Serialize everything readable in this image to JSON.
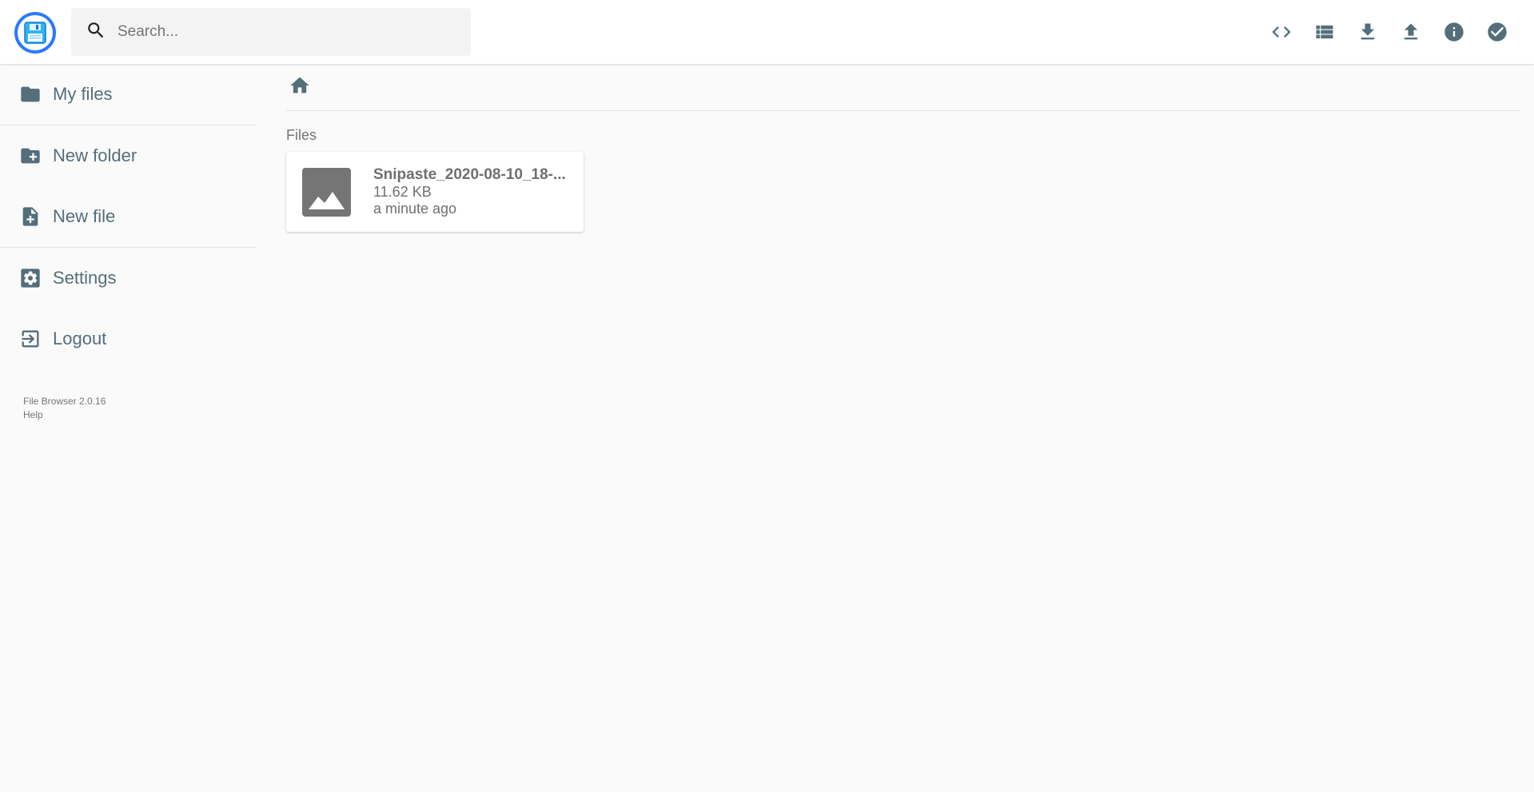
{
  "search": {
    "placeholder": "Search..."
  },
  "header": {
    "actions": [
      {
        "name": "toggle-code-button",
        "icon": "code-icon"
      },
      {
        "name": "toggle-list-view-button",
        "icon": "view-list-icon"
      },
      {
        "name": "download-button",
        "icon": "download-icon"
      },
      {
        "name": "upload-button",
        "icon": "upload-icon"
      },
      {
        "name": "info-button",
        "icon": "info-icon"
      },
      {
        "name": "select-button",
        "icon": "check-circle-icon"
      }
    ]
  },
  "sidebar": {
    "items": [
      {
        "label": "My files",
        "icon": "folder-icon"
      },
      {
        "label": "New folder",
        "icon": "create-new-folder-icon"
      },
      {
        "label": "New file",
        "icon": "note-add-icon"
      },
      {
        "label": "Settings",
        "icon": "settings-icon"
      },
      {
        "label": "Logout",
        "icon": "logout-icon"
      }
    ],
    "credits": {
      "version": "File Browser 2.0.16",
      "help": "Help"
    }
  },
  "main": {
    "breadcrumb_icon": "home-icon",
    "section_title": "Files",
    "files": [
      {
        "name": "Snipaste_2020-08-10_18-...",
        "size": "11.62 KB",
        "modified": "a minute ago",
        "icon": "image-icon"
      }
    ]
  },
  "colors": {
    "accent": "#2979ff",
    "icon": "#546e7a",
    "text": "#546e7a",
    "background": "#fafafa"
  }
}
